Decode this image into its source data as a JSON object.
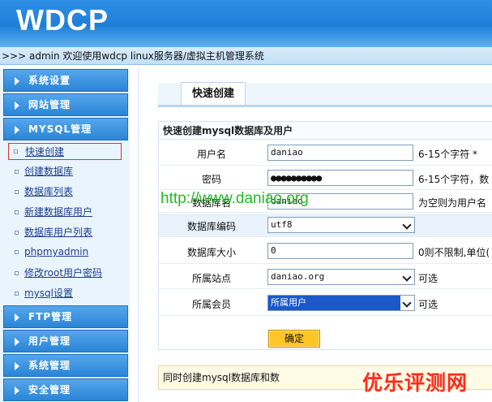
{
  "header": {
    "logo": "WDCP",
    "welcome": ">>> admin 欢迎使用wdcp linux服务器/虚拟主机管理系统"
  },
  "sidebar": {
    "groups": [
      {
        "label": "系统设置"
      },
      {
        "label": "网站管理"
      },
      {
        "label": "MYSQL管理"
      },
      {
        "label": "FTP管理"
      },
      {
        "label": "用户管理"
      },
      {
        "label": "系统管理"
      },
      {
        "label": "安全管理"
      }
    ],
    "mysql_items": [
      {
        "label": "快速创建",
        "active": true
      },
      {
        "label": "创建数据库"
      },
      {
        "label": "数据库列表"
      },
      {
        "label": "新建数据库用户"
      },
      {
        "label": "数据库用户列表"
      },
      {
        "label": "phpmyadmin"
      },
      {
        "label": "修改root用户密码"
      },
      {
        "label": "mysql设置"
      }
    ]
  },
  "main": {
    "tab": "快速创建",
    "form_title": "快速创建mysql数据库及用户",
    "fields": {
      "username": {
        "label": "用户名",
        "value": "daniao",
        "hint": "6-15个字符 *"
      },
      "password": {
        "label": "密码",
        "value": "●●●●●●●●●●",
        "hint": "6-15个字符，数"
      },
      "dbname": {
        "label": "数据库名",
        "value": "daniao",
        "hint": "为空则为用户名"
      },
      "encoding": {
        "label": "数据库编码",
        "value": "utf8"
      },
      "size": {
        "label": "数据库大小",
        "value": "0",
        "hint": "0则不限制,单位("
      },
      "site": {
        "label": "所属站点",
        "value": "daniao.org",
        "hint": "可选"
      },
      "member": {
        "label": "所属会员",
        "value": "所属用户",
        "hint": "可选"
      }
    },
    "submit_label": "确定",
    "note": "同时创建mysql数据库和数"
  },
  "overlay": {
    "watermark": "http://www.daniao.org",
    "corner_brand": "优乐评测网",
    "watermark_color": "#22bb22",
    "corner_color": "#ff2a1a"
  },
  "colors": {
    "header_blue": "#1f7fd8",
    "sidebar_head": "#2a85d6",
    "submit_yellow": "#ffc626",
    "select_highlight": "#1c58c8"
  }
}
